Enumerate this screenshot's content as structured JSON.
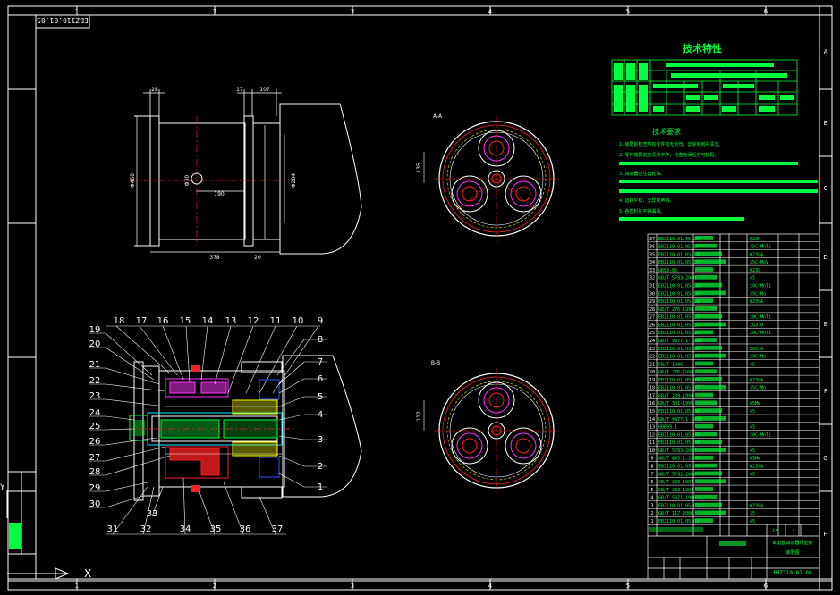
{
  "drawing": {
    "title_box_rotated": "EBZ110.01.05",
    "code": "EBZ110.01.05",
    "tech_char_title": "技术特性",
    "tech_req_title": "技术要求",
    "tech_req_lines": [
      "1. 装配前检查所有零件有无划伤，去除毛刺并清洗。",
      "2. 零件装配前应清洗干净，检查无误后方可装配。",
      "3. 减速器应注齿轮油。",
      "4. 运转平稳，无异常声响。",
      "5. 各密封处不得漏油。"
    ]
  },
  "grid": {
    "top": [
      "1",
      "2",
      "3",
      "4",
      "5",
      "6"
    ],
    "side": [
      "A",
      "B",
      "C",
      "D",
      "E",
      "F",
      "G",
      "H"
    ]
  },
  "dimensions": {
    "d_left": "28",
    "d_17": "17",
    "d_107": "107",
    "d_190": "190",
    "d_378": "378",
    "d_20": "20",
    "d_phi_a": "Φ460",
    "d_phi_b": "Φ284",
    "d_phi_c": "Φ30",
    "d_top_view": "135",
    "d_bot_view": "112"
  },
  "section_labels": {
    "a": "A-A",
    "b": "B-B"
  },
  "balloons": {
    "top": [
      "18",
      "17",
      "16",
      "15",
      "14",
      "13",
      "12",
      "11",
      "10",
      "9"
    ],
    "left": [
      "19",
      "20",
      "21",
      "22",
      "23",
      "24",
      "25",
      "26",
      "27",
      "28",
      "29",
      "30"
    ],
    "right": [
      "8",
      "7",
      "6",
      "5",
      "4",
      "3",
      "2",
      "1"
    ],
    "bottom": [
      "31",
      "32",
      "33",
      "34",
      "35",
      "36",
      "37"
    ]
  },
  "bom": {
    "rows": [
      {
        "n": "37",
        "code": "EBZ110.01.05-20",
        "m": "Q235"
      },
      {
        "n": "36",
        "code": "EBZ110.01.05-19",
        "m": "35CrMnTi"
      },
      {
        "n": "35",
        "code": "EBZ110.01.05-18",
        "m": "Q235A"
      },
      {
        "n": "34",
        "code": "EBZ110.01.05-17",
        "m": "35CrMoV"
      },
      {
        "n": "33",
        "code": "GB93-85",
        "m": "Q235"
      },
      {
        "n": "32",
        "code": "GB/T 5783-2000",
        "m": "45"
      },
      {
        "n": "31",
        "code": "EBZ110.01.05-16",
        "m": "20CrMnTi"
      },
      {
        "n": "30",
        "code": "EBZ110.01.05-15",
        "m": "35CrMo"
      },
      {
        "n": "29",
        "code": "EBZ110.01.05-14",
        "m": "Q235A"
      },
      {
        "n": "28",
        "code": "GB/T 276-1994",
        "m": ""
      },
      {
        "n": "27",
        "code": "EBZ110.01.05-13",
        "m": "20CrMnTi"
      },
      {
        "n": "26",
        "code": "EBZ110.01.05-12",
        "m": "ZG310"
      },
      {
        "n": "25",
        "code": "EBZ110.01.05-11",
        "m": "20CrMnTi"
      },
      {
        "n": "24",
        "code": "GB/T 9877.1-1988",
        "m": ""
      },
      {
        "n": "23",
        "code": "EBZ110.01.05-10",
        "m": "ZG310"
      },
      {
        "n": "22",
        "code": "EBZ110.01.05-09",
        "m": "20CrMo"
      },
      {
        "n": "21",
        "code": "GB/T 1096",
        "m": "45"
      },
      {
        "n": "20",
        "code": "GB/T 276-1994",
        "m": ""
      },
      {
        "n": "19",
        "code": "EBZ110.01.05-08",
        "m": "Q235A"
      },
      {
        "n": "18",
        "code": "EBZ110.01.05-07",
        "m": "35CrMo"
      },
      {
        "n": "17",
        "code": "GB/T 289-1994",
        "m": ""
      },
      {
        "n": "16",
        "code": "GB/T 301-1995",
        "m": "65Mn"
      },
      {
        "n": "15",
        "code": "EBZ110.01.05-06",
        "m": "45"
      },
      {
        "n": "14",
        "code": "GB/T 9877.1-1988",
        "m": ""
      },
      {
        "n": "13",
        "code": "GB893.1",
        "m": "45"
      },
      {
        "n": "12",
        "code": "EBZ110.01.05-05",
        "m": "20CrMnTi"
      },
      {
        "n": "11",
        "code": "EBZ110.01.05-04",
        "m": ""
      },
      {
        "n": "10",
        "code": "GB/T 5783-2000",
        "m": "45"
      },
      {
        "n": "9",
        "code": "GB/T 893.1-1986",
        "m": "65Mn"
      },
      {
        "n": "8",
        "code": "EBZ110.01.05-03",
        "m": "Q235A"
      },
      {
        "n": "7",
        "code": "GB/T 5782-2000",
        "m": "45"
      },
      {
        "n": "6",
        "code": "GB/T 283-1994",
        "m": ""
      },
      {
        "n": "5",
        "code": "GB/T 283-1994",
        "m": ""
      },
      {
        "n": "4",
        "code": "GB/T 5871-1986",
        "m": ""
      },
      {
        "n": "3",
        "code": "EBZ110.01.05-02",
        "m": "Q235A"
      },
      {
        "n": "2",
        "code": "GB/T 117-2000",
        "m": "35"
      },
      {
        "n": "1",
        "code": "EBZ110.01.05-01",
        "m": "45"
      }
    ]
  },
  "title_block": {
    "name": "截割部减速器行星级",
    "sub": "装配图",
    "scale": "1:5",
    "sheet": "1"
  },
  "colors": {
    "bg": "#000000",
    "white": "#ffffff",
    "red": "#ff2020",
    "green": "#00ff3c",
    "yellow": "#ffff00",
    "magenta": "#ff33ff",
    "cyan": "#00e6ff",
    "blue": "#3355ff"
  }
}
